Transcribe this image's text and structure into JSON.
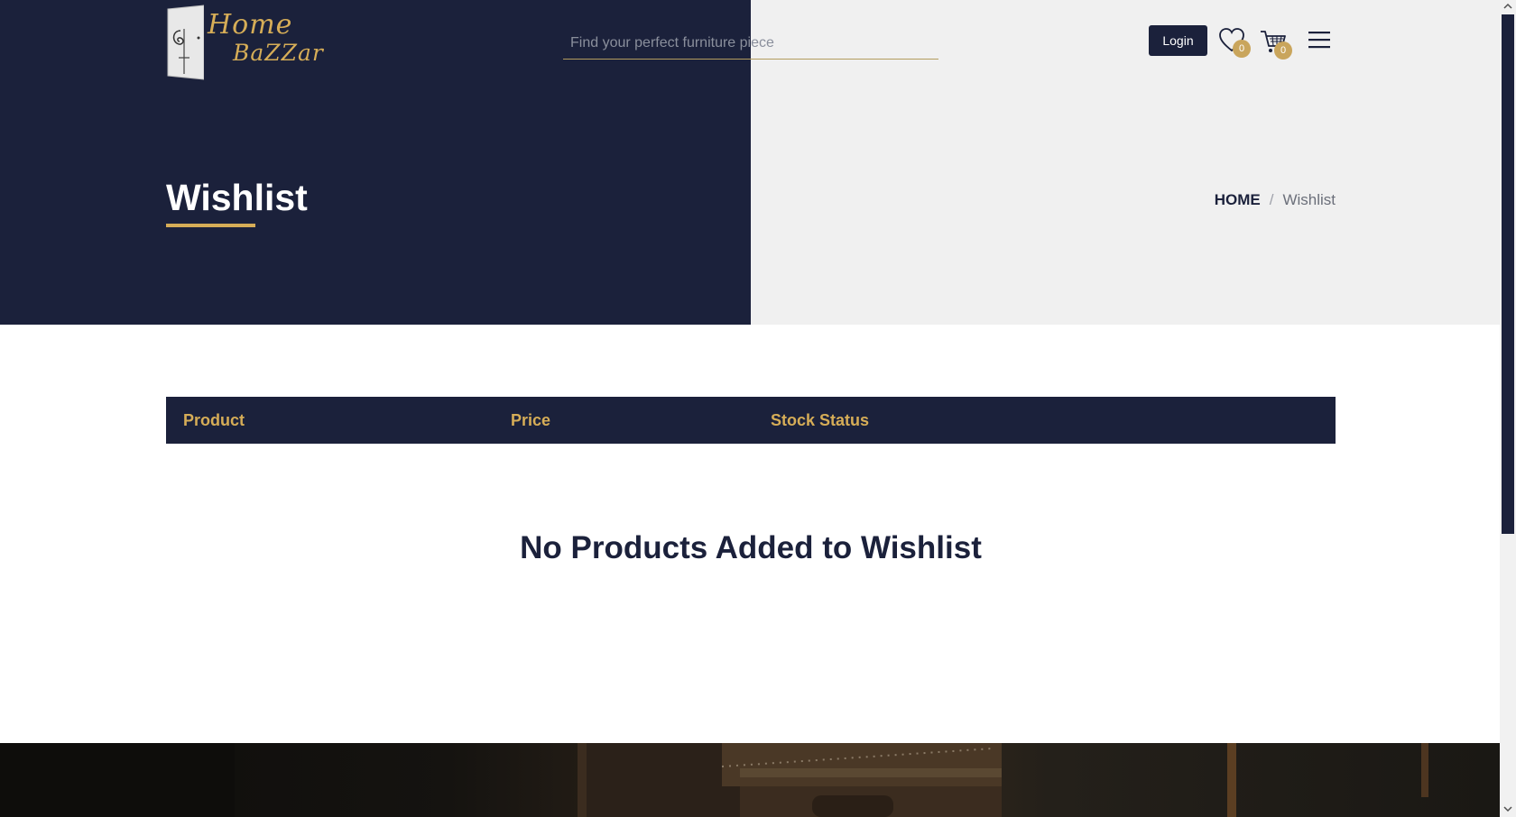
{
  "header": {
    "logo_line1": "Home",
    "logo_line2": "BaZZar",
    "search_placeholder": "Find your perfect furniture piece",
    "login_label": "Login",
    "wishlist_count": "0",
    "cart_count": "0"
  },
  "hero": {
    "title": "Wishlist",
    "breadcrumb_home": "HOME",
    "breadcrumb_separator": "/",
    "breadcrumb_current": "Wishlist"
  },
  "table": {
    "columns": [
      "Product",
      "Price",
      "Stock Status"
    ],
    "empty_message": "No Products Added to Wishlist"
  },
  "colors": {
    "navy": "#1b213b",
    "gold": "#d6ad57",
    "light_gray": "#f0f0f0"
  },
  "icons": [
    "heart-icon",
    "cart-icon",
    "hamburger-menu-icon",
    "logo-door-icon"
  ]
}
